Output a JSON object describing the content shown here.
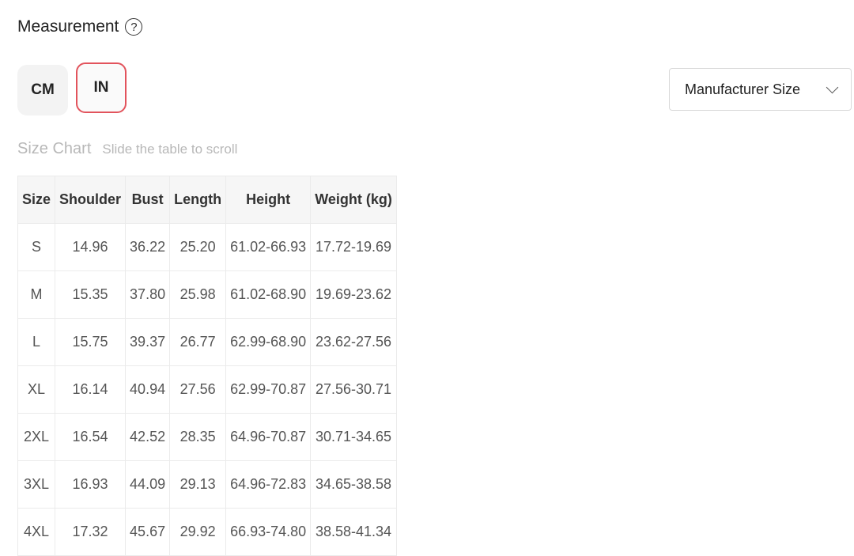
{
  "header": {
    "title": "Measurement",
    "help_icon": "question-circle-icon",
    "help_glyph": "?"
  },
  "units": {
    "options": [
      "CM",
      "IN"
    ],
    "selected": "IN",
    "accent_color": "#e2535c"
  },
  "size_select": {
    "value": "Manufacturer Size",
    "icon": "chevron-down-icon"
  },
  "chart_caption": {
    "title": "Size Chart",
    "hint": "Slide the table to scroll"
  },
  "table": {
    "columns": [
      "Size",
      "Shoulder",
      "Bust",
      "Length",
      "Height",
      "Weight (kg)"
    ],
    "rows": [
      [
        "S",
        "14.96",
        "36.22",
        "25.20",
        "61.02-66.93",
        "17.72-19.69"
      ],
      [
        "M",
        "15.35",
        "37.80",
        "25.98",
        "61.02-68.90",
        "19.69-23.62"
      ],
      [
        "L",
        "15.75",
        "39.37",
        "26.77",
        "62.99-68.90",
        "23.62-27.56"
      ],
      [
        "XL",
        "16.14",
        "40.94",
        "27.56",
        "62.99-70.87",
        "27.56-30.71"
      ],
      [
        "2XL",
        "16.54",
        "42.52",
        "28.35",
        "64.96-70.87",
        "30.71-34.65"
      ],
      [
        "3XL",
        "16.93",
        "44.09",
        "29.13",
        "64.96-72.83",
        "34.65-38.58"
      ],
      [
        "4XL",
        "17.32",
        "45.67",
        "29.92",
        "66.93-74.80",
        "38.58-41.34"
      ]
    ]
  }
}
